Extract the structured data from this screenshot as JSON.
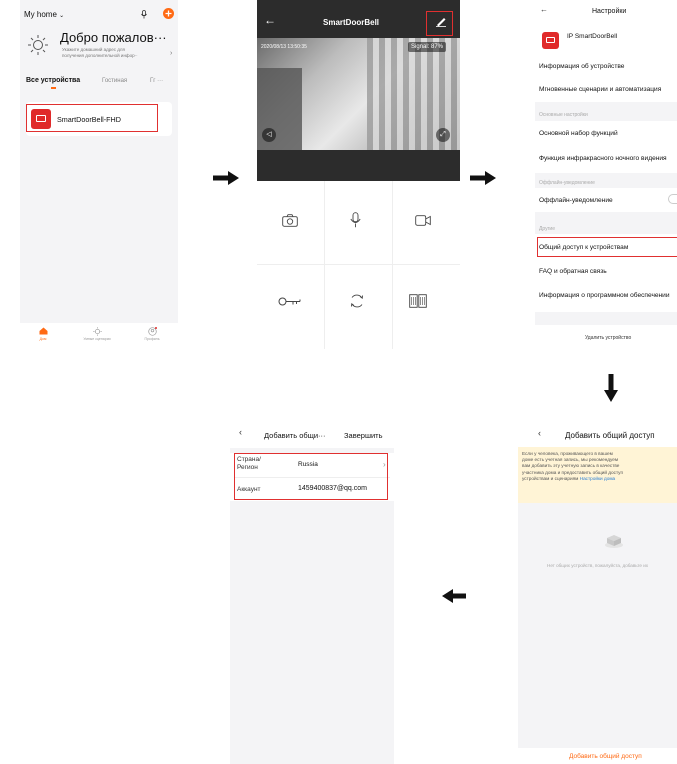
{
  "colors": {
    "accent_orange": "#ff6a14",
    "brand_red": "#e02a2a",
    "highlight_red": "#e03030",
    "notice_yellow": "#fff4d6"
  },
  "panel_home": {
    "home_label": "My home",
    "welcome_title": "Добро пожалов···",
    "welcome_subtitle_1": "Укажите домашний адрес для",
    "welcome_subtitle_2": "получения дополнительной инфор··",
    "tabs": [
      "Все устройства",
      "Гостиная",
      "Гг ···"
    ],
    "device_name": "SmartDoorBell-FHD",
    "bottom_nav": [
      "Дом",
      "Умные сценарии",
      "Профиль"
    ]
  },
  "panel_camera": {
    "title": "SmartDoorBell",
    "timestamp": "2020/08/13 13:50:35",
    "signal": "Signal: 87%"
  },
  "panel_settings": {
    "title": "Настройки",
    "device_name": "IP SmartDoorBell",
    "items_top": [
      "Информация об устройстве",
      "Мгновенные сценарии и автоматизация"
    ],
    "section_basic": "Основные настройки",
    "items_basic": [
      "Основной набор функций",
      "Функция инфракрасного ночного видения"
    ],
    "section_offline": "Оффлайн-уведомление",
    "offline_item": "Оффлайн-уведомление",
    "section_other": "Другие",
    "items_other": [
      "Общий доступ к устройствам",
      "FAQ и обратная связь",
      "Информация о программном обеспечении"
    ],
    "remove_device": "Удалить устройство"
  },
  "panel_share": {
    "title": "Добавить общий доступ",
    "notice_lines": [
      "Если у человека, проживающего в вашем",
      "доме есть учетная запись, мы рекомендуем",
      "вам добавить эту учетную запись в качестве",
      "участника дома и предоставить общий доступ",
      "устройствам и сценариям"
    ],
    "notice_link": "Настройки дома",
    "empty_text": "Нет общих устройств, пожалуйста, добавьте их",
    "add_button": "Добавить общий доступ"
  },
  "panel_add": {
    "title": "Добавить общи···",
    "done": "Завершить",
    "region_label_1": "Страна/",
    "region_label_2": "Регион",
    "region_value": "Russia",
    "account_label": "Аккаунт",
    "account_value": "1459400837@qq.com"
  }
}
